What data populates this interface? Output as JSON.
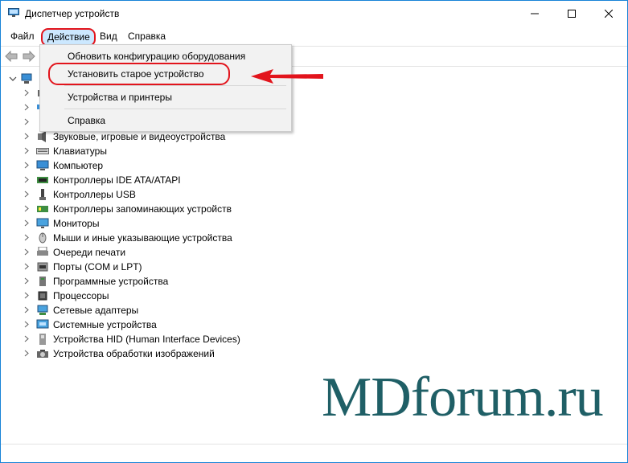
{
  "window": {
    "title": "Диспетчер устройств"
  },
  "menu": {
    "file": "Файл",
    "action": "Действие",
    "view": "Вид",
    "help": "Справка"
  },
  "dropdown": {
    "items": [
      "Обновить конфигурацию оборудования",
      "Установить старое устройство",
      "Устройства и принтеры",
      "Справка"
    ]
  },
  "tree": {
    "rows": [
      {
        "label": "Звуковые, игровые и видеоустройства",
        "icon": "speaker-icon"
      },
      {
        "label": "Клавиатуры",
        "icon": "keyboard-icon"
      },
      {
        "label": "Компьютер",
        "icon": "computer-icon"
      },
      {
        "label": "Контроллеры IDE ATA/ATAPI",
        "icon": "ide-controller-icon"
      },
      {
        "label": "Контроллеры USB",
        "icon": "usb-icon"
      },
      {
        "label": "Контроллеры запоминающих устройств",
        "icon": "storage-controller-icon"
      },
      {
        "label": "Мониторы",
        "icon": "monitor-icon"
      },
      {
        "label": "Мыши и иные указывающие устройства",
        "icon": "mouse-icon"
      },
      {
        "label": "Очереди печати",
        "icon": "printer-icon"
      },
      {
        "label": "Порты (COM и LPT)",
        "icon": "port-icon"
      },
      {
        "label": "Программные устройства",
        "icon": "software-device-icon"
      },
      {
        "label": "Процессоры",
        "icon": "processor-icon"
      },
      {
        "label": "Сетевые адаптеры",
        "icon": "network-adapter-icon"
      },
      {
        "label": "Системные устройства",
        "icon": "system-device-icon"
      },
      {
        "label": "Устройства HID (Human Interface Devices)",
        "icon": "hid-icon"
      },
      {
        "label": "Устройства обработки изображений",
        "icon": "imaging-device-icon"
      }
    ]
  },
  "watermark": "MDforum.ru",
  "colors": {
    "accent": "#e2141c",
    "selection": "#cce8ff",
    "border": "#1883d7",
    "watermark": "#1f5f66"
  }
}
